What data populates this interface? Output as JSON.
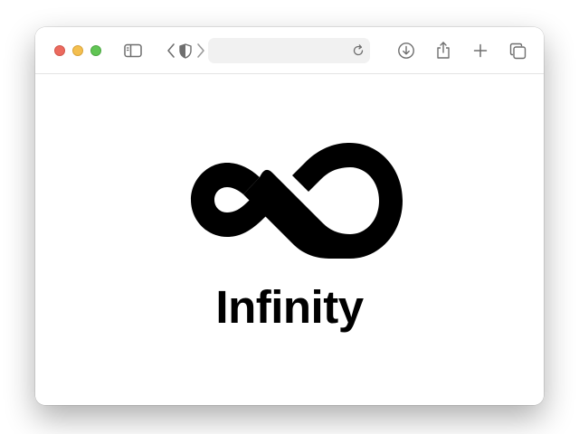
{
  "browser": {
    "address_bar": {
      "value": "",
      "placeholder": ""
    },
    "toolbar_icons": [
      "sidebar-toggle-icon",
      "back-chevron-icon",
      "privacy-shield-icon",
      "forward-chevron-icon",
      "reload-icon",
      "download-icon",
      "share-icon",
      "new-tab-plus-icon",
      "tab-overview-icon"
    ],
    "traffic_light_colors": {
      "close": "#ec6a5e",
      "minimize": "#f4bf4f",
      "maximize": "#61c554"
    }
  },
  "page": {
    "logo_icon": "infinity-icon",
    "brand_name": "Infinity",
    "logo_color": "#000000"
  }
}
